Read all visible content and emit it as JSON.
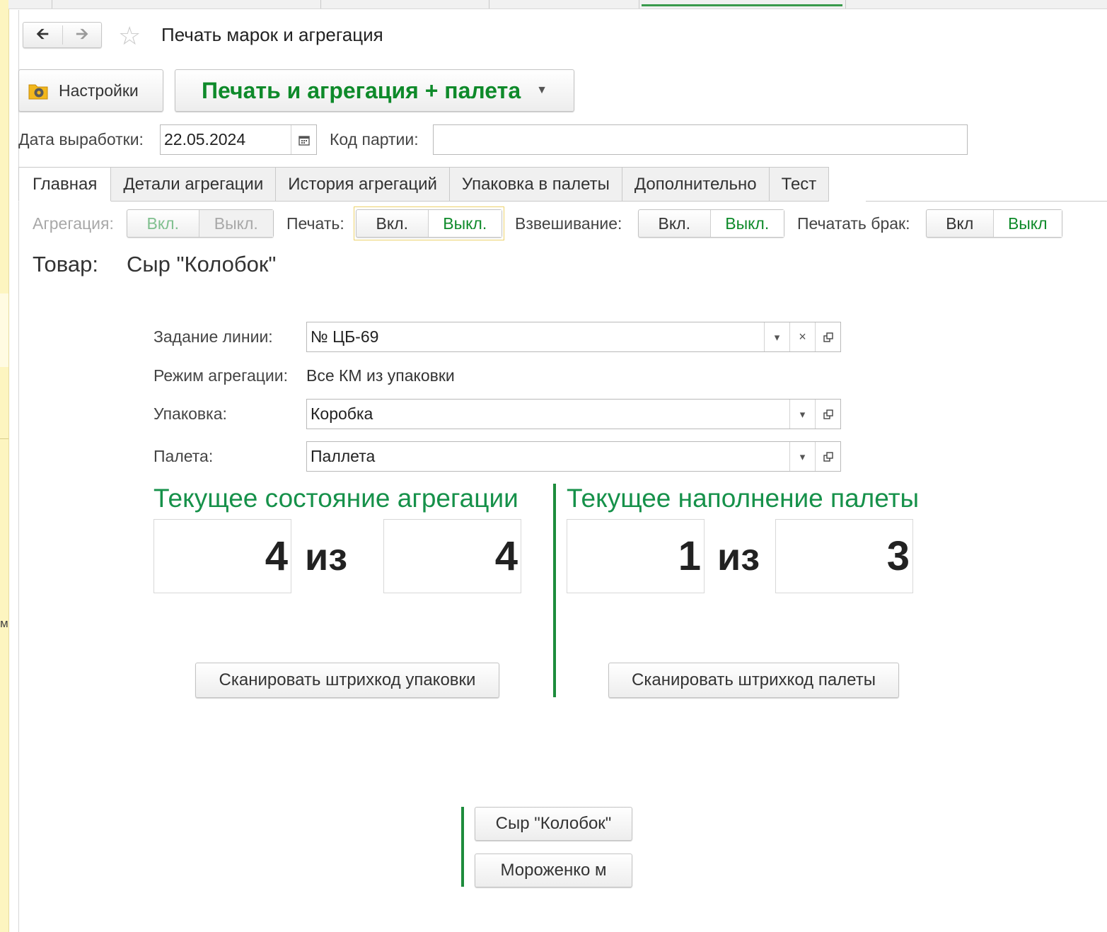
{
  "window": {
    "title": "Печать марок и агрегация"
  },
  "side": {
    "letter": "м"
  },
  "toolbar": {
    "settings_label": "Настройки",
    "main_command_label": "Печать и агрегация + палета"
  },
  "header": {
    "production_date_label": "Дата выработки:",
    "production_date_value": "22.05.2024",
    "batch_code_label": "Код партии:",
    "batch_code_value": ""
  },
  "tabs": [
    {
      "label": "Главная",
      "active": true
    },
    {
      "label": "Детали агрегации",
      "active": false
    },
    {
      "label": "История агрегаций",
      "active": false
    },
    {
      "label": "Упаковка в палеты",
      "active": false
    },
    {
      "label": "Дополнительно",
      "active": false
    },
    {
      "label": "Тест",
      "active": false
    }
  ],
  "toggles": {
    "aggregation": {
      "label": "Агрегация:",
      "on": "Вкл.",
      "off": "Выкл.",
      "selected": "on",
      "disabled": true
    },
    "print": {
      "label": "Печать:",
      "on": "Вкл.",
      "off": "Выкл.",
      "selected": "off"
    },
    "weighing": {
      "label": "Взвешивание:",
      "on": "Вкл.",
      "off": "Выкл.",
      "selected": "off"
    },
    "print_defect": {
      "label": "Печатать брак:",
      "on": "Вкл",
      "off": "Выкл",
      "selected": "off"
    }
  },
  "product": {
    "label": "Товар:",
    "value": "Сыр \"Колобок\""
  },
  "form": {
    "line_task_label": "Задание линии:",
    "line_task_value": "№ ЦБ-69",
    "mode_label": "Режим агрегации:",
    "mode_value": "Все КМ из упаковки",
    "package_label": "Упаковка:",
    "package_value": "Коробка",
    "pallet_label": "Палета:",
    "pallet_value": "Паллета"
  },
  "aggregation_state": {
    "title": "Текущее состояние агрегации",
    "current": "4",
    "of": "из",
    "total": "4",
    "scan_button": "Сканировать штрихкод упаковки"
  },
  "pallet_state": {
    "title": "Текущее наполнение палеты",
    "current": "1",
    "of": "из",
    "total": "3",
    "scan_button": "Сканировать штрихкод палеты"
  },
  "product_buttons": [
    "Сыр \"Колобок\"",
    "Мороженко м"
  ],
  "colors": {
    "accent_green": "#0e8a2a",
    "title_green": "#16914a",
    "divider_green": "#1d8c3c",
    "side_yellow": "#fdf5c0"
  }
}
